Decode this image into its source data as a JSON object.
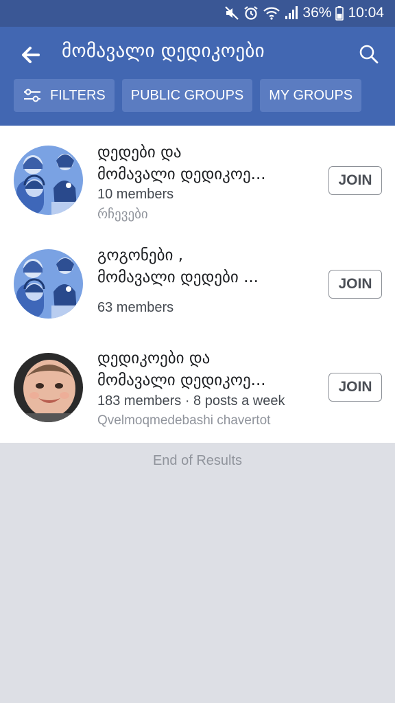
{
  "status_bar": {
    "battery": "36%",
    "time": "10:04",
    "icons": [
      "mute-icon",
      "alarm-icon",
      "wifi-icon",
      "signal-icon",
      "battery-icon"
    ]
  },
  "header": {
    "title": "მომავალი დედიკოები",
    "chips": [
      {
        "label": "FILTERS",
        "icon": "filter-sliders-icon"
      },
      {
        "label": "PUBLIC GROUPS"
      },
      {
        "label": "MY GROUPS"
      }
    ]
  },
  "results": [
    {
      "name_line1": "დედები და",
      "name_line2": "მომავალი დედიკოე...",
      "members": "10 members",
      "subtitle": "რჩევები",
      "join_label": "JOIN",
      "avatar": "illustration-avatar"
    },
    {
      "name_line1": "გოგონები ,",
      "name_line2": "მომავალი დედები ...",
      "members": "63 members",
      "subtitle": "",
      "join_label": "JOIN",
      "avatar": "illustration-avatar"
    },
    {
      "name_line1": "დედიკოები და",
      "name_line2": "მომავალი დედიკოე...",
      "members": "183 members · 8 posts a week",
      "subtitle": "Qvelmoqmedebashi chavertot",
      "join_label": "JOIN",
      "avatar": "baby-photo-avatar"
    }
  ],
  "footer": {
    "end_text": "End of Results"
  },
  "colors": {
    "header": "#4267b2",
    "status_bar": "#3a5795",
    "chip": "#5b7cc1",
    "page_bg": "#dddfe5"
  }
}
